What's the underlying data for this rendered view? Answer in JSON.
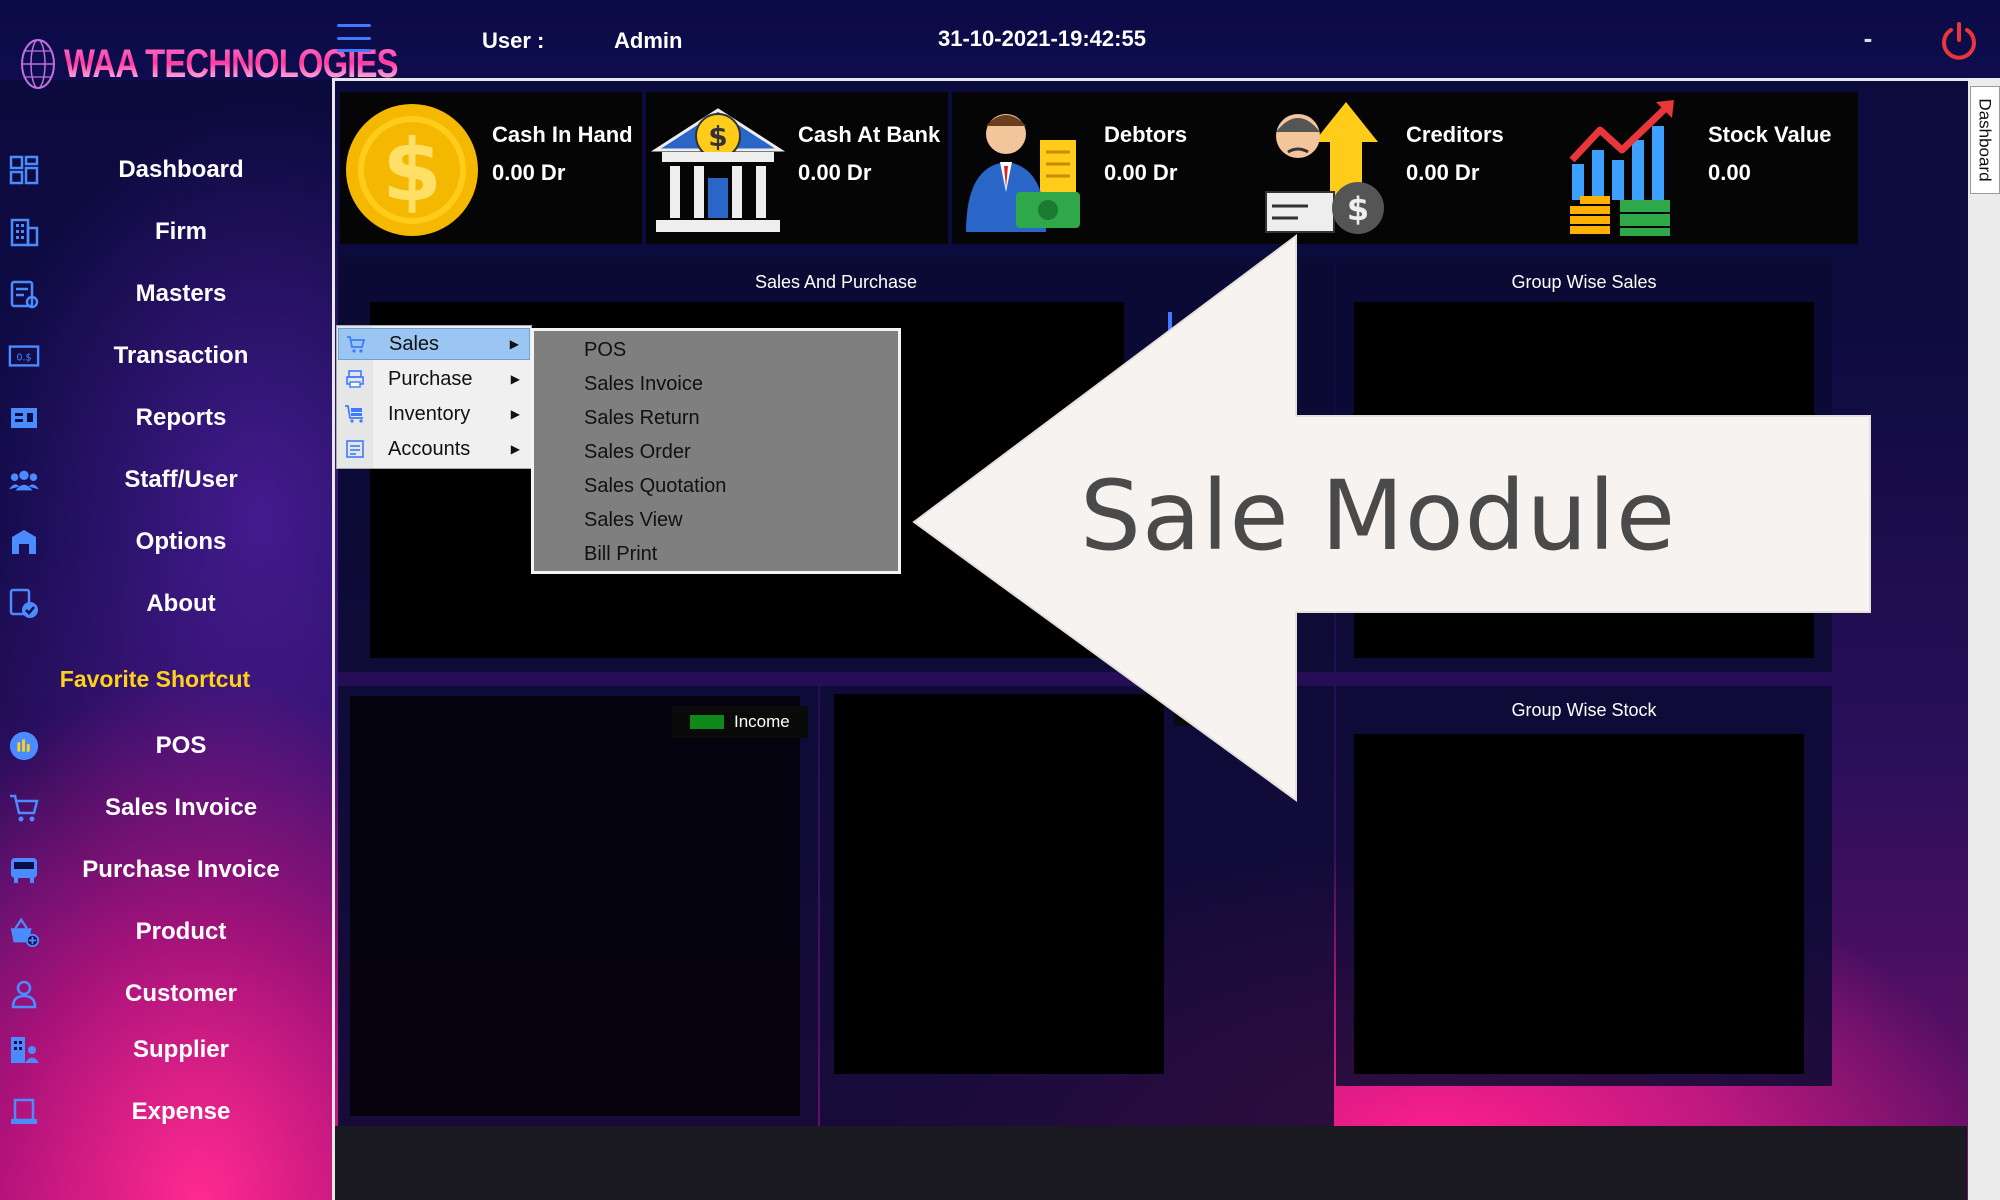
{
  "app": {
    "logo_text": "WAA TECHNOLOGIES",
    "user_label": "User :",
    "user_name": "Admin",
    "datetime": "31-10-2021-19:42:55",
    "minimize_glyph": "-",
    "side_tab": "Dashboard"
  },
  "sidebar": {
    "items": [
      {
        "label": "Dashboard",
        "icon": "dashboard-icon"
      },
      {
        "label": "Firm",
        "icon": "building-icon"
      },
      {
        "label": "Masters",
        "icon": "masters-icon"
      },
      {
        "label": "Transaction",
        "icon": "transaction-icon"
      },
      {
        "label": "Reports",
        "icon": "reports-icon"
      },
      {
        "label": "Staff/User",
        "icon": "users-icon"
      },
      {
        "label": "Options",
        "icon": "options-icon"
      },
      {
        "label": "About",
        "icon": "about-icon"
      }
    ],
    "favorite_title": "Favorite Shortcut",
    "favorites": [
      {
        "label": "POS",
        "icon": "pos-icon"
      },
      {
        "label": "Sales Invoice",
        "icon": "cart-icon"
      },
      {
        "label": "Purchase Invoice",
        "icon": "bus-icon"
      },
      {
        "label": "Product",
        "icon": "product-icon"
      },
      {
        "label": "Customer",
        "icon": "customer-icon"
      },
      {
        "label": "Supplier",
        "icon": "supplier-icon"
      },
      {
        "label": "Expense",
        "icon": "expense-icon"
      }
    ]
  },
  "cards": [
    {
      "title": "Cash In Hand",
      "value": "0.00  Dr",
      "icon": "coin-icon"
    },
    {
      "title": "Cash At Bank",
      "value": "0.00  Dr",
      "icon": "bank-icon"
    },
    {
      "title": "Debtors",
      "value": "0.00  Dr",
      "icon": "debtor-icon"
    },
    {
      "title": "Creditors",
      "value": "0.00  Dr",
      "icon": "creditor-icon"
    },
    {
      "title": "Stock Value",
      "value": "0.00",
      "icon": "stock-chart-icon"
    }
  ],
  "panels": {
    "sales_purchase": "Sales And Purchase",
    "group_wise_sales": "Group Wise Sales",
    "group_wise_stock": "Group Wise Stock",
    "income_legend": "Income"
  },
  "context_menu": {
    "items": [
      {
        "label": "Sales",
        "icon": "cart-icon",
        "active": true
      },
      {
        "label": "Purchase",
        "icon": "printer-icon",
        "active": false
      },
      {
        "label": "Inventory",
        "icon": "inventory-icon",
        "active": false
      },
      {
        "label": "Accounts",
        "icon": "accounts-icon",
        "active": false
      }
    ],
    "submenu": [
      "POS",
      "Sales Invoice",
      "Sales Return",
      "Sales Order",
      "Sales Quotation",
      "Sales View",
      "Bill Print"
    ]
  },
  "annotation": {
    "text": "Sale Module"
  },
  "colors": {
    "accent_blue": "#3d7bff",
    "power_red": "#e8363a",
    "favorite_yellow": "#ffd21a",
    "legend_green": "#0f8a1a",
    "menu_highlight": "#9bc6f1"
  }
}
